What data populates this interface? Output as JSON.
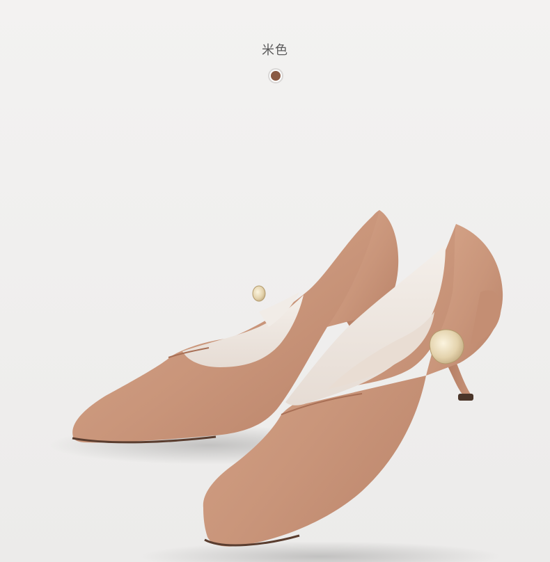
{
  "color_selector": {
    "label": "米色",
    "swatch_color": "#8a5a43"
  },
  "product": {
    "icon": "beige-pointed-toe-pumps-image",
    "shoe_color": "#c9957a",
    "lining_color": "#efe8e2",
    "ornament_color": "#e3d4b4"
  }
}
